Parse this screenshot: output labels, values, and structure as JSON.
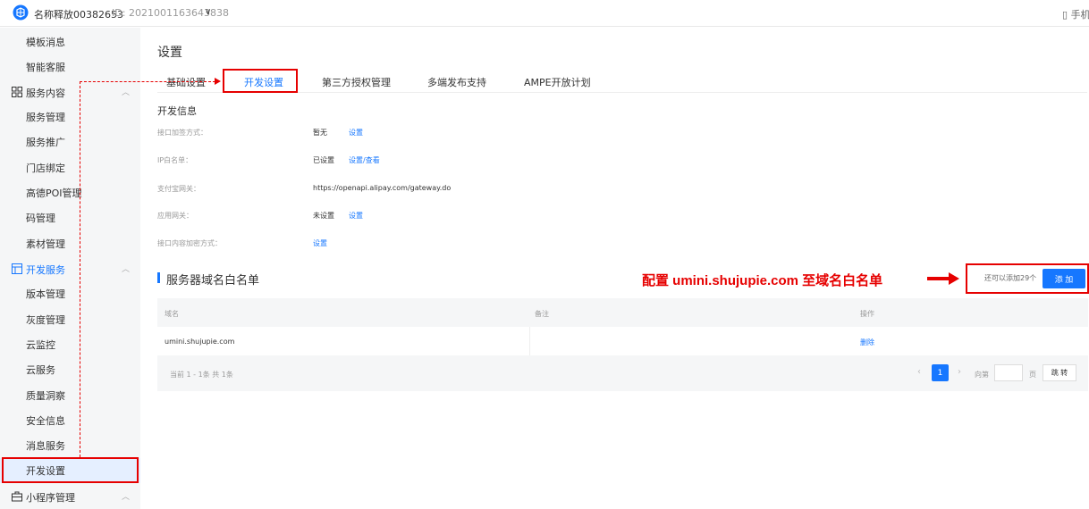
{
  "topbar": {
    "app_name": "名称释放00382653",
    "id_label": "ID:",
    "app_id": "2021001163643838",
    "right_text": "手机"
  },
  "sidebar": {
    "items": [
      {
        "label": "模板消息"
      },
      {
        "label": "智能客服"
      }
    ],
    "group_service": {
      "label": "服务内容"
    },
    "service_items": [
      {
        "label": "服务管理"
      },
      {
        "label": "服务推广"
      },
      {
        "label": "门店绑定"
      },
      {
        "label": "高德POI管理"
      },
      {
        "label": "码管理"
      },
      {
        "label": "素材管理"
      }
    ],
    "group_dev": {
      "label": "开发服务"
    },
    "dev_items": [
      {
        "label": "版本管理"
      },
      {
        "label": "灰度管理"
      },
      {
        "label": "云监控"
      },
      {
        "label": "云服务"
      },
      {
        "label": "质量洞察"
      },
      {
        "label": "安全信息"
      },
      {
        "label": "消息服务"
      },
      {
        "label": "开发设置"
      }
    ],
    "group_mini": {
      "label": "小程序管理"
    }
  },
  "main": {
    "title": "设置",
    "tabs": [
      {
        "label": "基础设置"
      },
      {
        "label": "开发设置"
      },
      {
        "label": "第三方授权管理"
      },
      {
        "label": "多端发布支持"
      },
      {
        "label": "AMPE开放计划"
      }
    ],
    "dev_info_title": "开发信息",
    "info_rows": [
      {
        "key": "接口加签方式：",
        "value": "暂无",
        "action": "设置"
      },
      {
        "key": "IP白名单：",
        "value": "已设置",
        "action": "设置/查看"
      },
      {
        "key": "支付宝网关：",
        "value": "https://openapi.alipay.com/gateway.do",
        "action": ""
      },
      {
        "key": "应用网关：",
        "value": "未设置",
        "action": "设置"
      },
      {
        "key": "接口内容加密方式：",
        "value": "",
        "action": "设置"
      }
    ],
    "whitelist": {
      "title": "服务器域名白名单",
      "hint": "还可以添加29个",
      "add_label": "添 加",
      "columns": [
        "域名",
        "备注",
        "操作"
      ],
      "rows": [
        {
          "domain": "umini.shujupie.com",
          "note": "",
          "action": "删除"
        }
      ],
      "summary": "当前 1 - 1条 共 1条",
      "current_page": "1",
      "goto_label": "向第",
      "page_label": "页",
      "jump_label": "跳 转"
    },
    "annotation": "配置 umini.shujupie.com 至域名白名单"
  },
  "colors": {
    "accent": "#1677ff",
    "annotation": "#e60000"
  }
}
